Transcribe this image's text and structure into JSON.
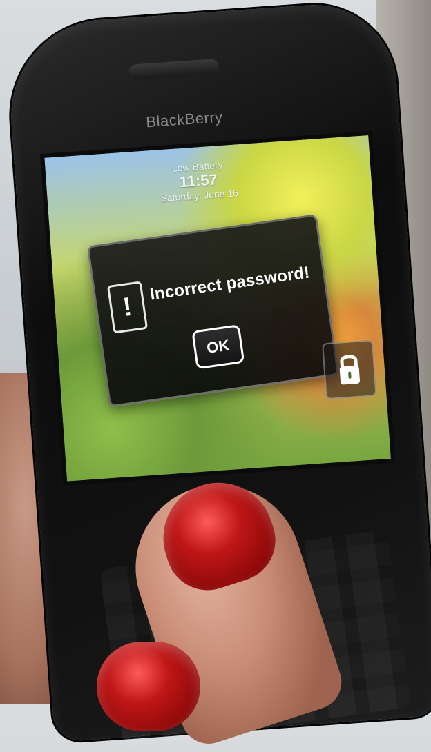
{
  "device": {
    "brand_text": "BlackBerry"
  },
  "lock_screen": {
    "line_1": "Low Battery",
    "time": "11:57",
    "line_3": "Saturday, June 16"
  },
  "dialog": {
    "icon_name": "info-icon",
    "icon_glyph": "!",
    "message": "Incorrect password!",
    "ok_label": "OK"
  },
  "unlock": {
    "icon_name": "lock-icon"
  },
  "colors": {
    "nail_red": "#c01717"
  }
}
